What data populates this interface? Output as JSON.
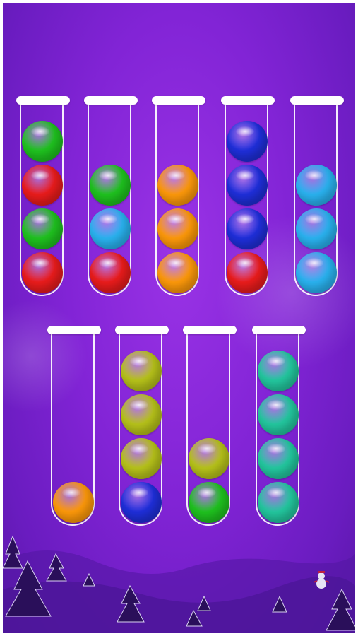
{
  "game": {
    "colors": {
      "red": "#ec1c1c",
      "green": "#1fc41f",
      "blue": "#1f2fdc",
      "light-blue": "#2ab4f2",
      "orange": "#ff9a0a",
      "yellow-green": "#b8c41a",
      "teal": "#23c9a0"
    },
    "tubes": [
      {
        "balls_bottom_to_top": [
          "red",
          "green",
          "red",
          "green"
        ]
      },
      {
        "balls_bottom_to_top": [
          "red",
          "light-blue",
          "green"
        ]
      },
      {
        "balls_bottom_to_top": [
          "orange",
          "orange",
          "orange"
        ]
      },
      {
        "balls_bottom_to_top": [
          "red",
          "blue",
          "blue",
          "blue"
        ]
      },
      {
        "balls_bottom_to_top": [
          "light-blue",
          "light-blue",
          "light-blue"
        ]
      },
      {
        "balls_bottom_to_top": [
          "orange"
        ]
      },
      {
        "balls_bottom_to_top": [
          "blue",
          "yellow-green",
          "yellow-green",
          "yellow-green"
        ]
      },
      {
        "balls_bottom_to_top": [
          "green",
          "yellow-green"
        ]
      },
      {
        "balls_bottom_to_top": [
          "teal",
          "teal",
          "teal",
          "teal"
        ]
      }
    ]
  }
}
